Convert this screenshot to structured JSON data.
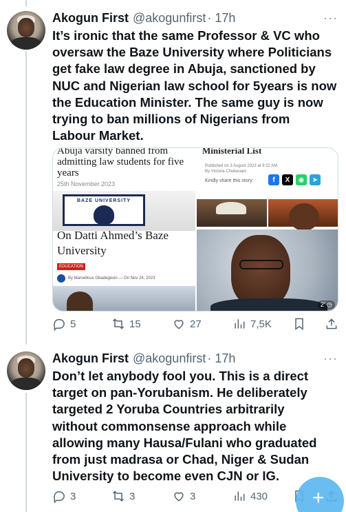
{
  "tweets": [
    {
      "name": "Akogun First",
      "handle": "@akogunfirst",
      "time": "· 17h",
      "more": "···",
      "lines": [
        "It’s ironic that the same Professor & VC who",
        "oversaw the Baze University where Politicians",
        "get fake law degree in Abuja, sanctioned by",
        "NUC and Nigerian law school for 5years is now",
        "the Education Minister. The same guy is now",
        "trying to ban millions of Nigerians from",
        "Labour Market."
      ],
      "media": {
        "left": {
          "headline": "Abuja varsity banned from admitting law students for five years",
          "date": "25th November 2023",
          "sign_text": "BAZE UNIVERSITY",
          "headline2": "On Datti Ahmed’s Baze University",
          "tag": "EDUCATION",
          "byline": "By  Marvellous Gbadegesin   —   On  Nov 24, 2023"
        },
        "right": {
          "headline": "Ministerial List",
          "published": "Published on 3 August 2023 at 9:22 AM",
          "author": "By Victoria Chukwuani",
          "share": "Kindly share this story:",
          "share_buttons": [
            "f",
            "X",
            "◉",
            "➤"
          ],
          "badge": "2' ◷"
        }
      },
      "actions": {
        "replies": "5",
        "reposts": "15",
        "likes": "27",
        "views": "7,5K"
      }
    },
    {
      "name": "Akogun First",
      "handle": "@akogunfirst",
      "time": "· 17h",
      "more": "···",
      "lines": [
        "Don’t let anybody fool you. This is a direct",
        "target on pan-Yorubanism. He deliberately",
        "targeted 2 Yoruba Countries arbitrarily",
        "without commonsense approach while",
        "allowing many Hausa/Fulani who graduated",
        "from just madrasa or Chad, Niger & Sudan",
        "University to become even CJN or IG."
      ],
      "actions": {
        "replies": "3",
        "reposts": "3",
        "likes": "3",
        "views": "430"
      }
    }
  ],
  "fab_icon": "+",
  "colors": {
    "accent": "#1d9bf0",
    "muted": "#536471",
    "line": "#cfd9de"
  }
}
